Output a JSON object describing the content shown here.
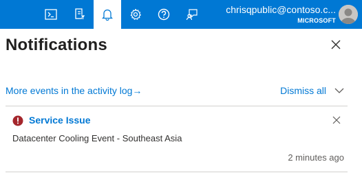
{
  "topbar": {
    "buttons": [
      {
        "name": "cloud-shell-icon"
      },
      {
        "name": "directory-filter-icon"
      },
      {
        "name": "notifications-bell-icon",
        "active": true
      },
      {
        "name": "settings-gear-icon"
      },
      {
        "name": "help-question-icon"
      },
      {
        "name": "feedback-icon"
      }
    ],
    "account_email": "chrisqpublic@contoso.c...",
    "account_tenant": "MICROSOFT"
  },
  "panel": {
    "title": "Notifications",
    "activity_link": "More events in the activity log",
    "activity_arrow": "→",
    "dismiss_all": "Dismiss all"
  },
  "notifications": [
    {
      "status": "error",
      "title": "Service Issue",
      "description": "Datacenter Cooling Event - Southeast Asia",
      "time": "2 minutes ago"
    }
  ],
  "colors": {
    "accent": "#0078d4",
    "error": "#a4262c"
  }
}
